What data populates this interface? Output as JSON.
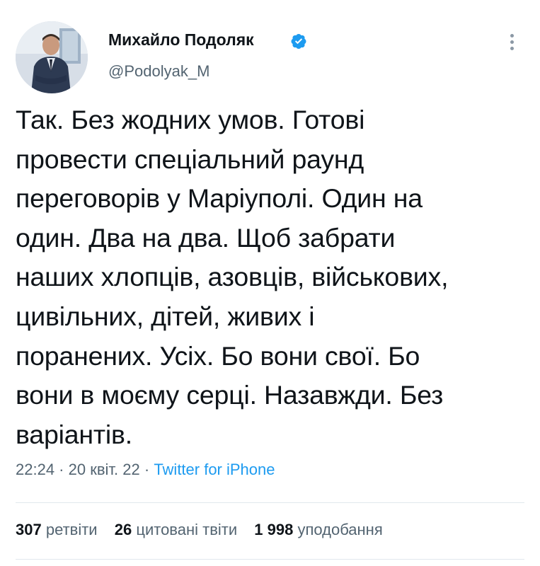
{
  "author": {
    "name": "Михайло Подоляк",
    "handle": "@Podolyak_M",
    "verified": true,
    "verified_color": "#1d9bf0"
  },
  "tweet": {
    "text": "Так. Без жодних умов. Готові\nпровести спеціальний раунд\nпереговорів у Маріуполі. Один на\nодин. Два на два. Щоб забрати\nнаших хлопців, азовців, військових,\nцивільних, дітей, живих і\nпоранених. Усіх. Бо вони свої. Бо\nвони в моєму серці. Назавжди. Без\nваріантів."
  },
  "meta": {
    "time": "22:24",
    "sep1": " · ",
    "date": "20 квіт. 22",
    "sep2": " · ",
    "source": "Twitter for iPhone"
  },
  "stats": {
    "retweets_count": "307",
    "retweets_label": "ретвіти",
    "quotes_count": "26",
    "quotes_label": "цитовані твіти",
    "likes_count": "1 998",
    "likes_label": "уподобання"
  },
  "icons": {
    "verified": "verified-badge-icon",
    "more": "more-options-icon"
  }
}
